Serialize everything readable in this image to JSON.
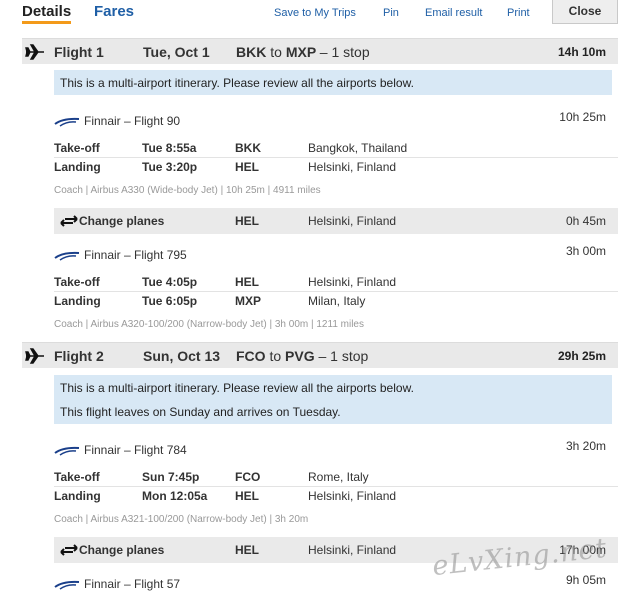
{
  "tabs": {
    "details": "Details",
    "fares": "Fares"
  },
  "toolbar": {
    "save": "Save to My Trips",
    "pin": "Pin",
    "email": "Email result",
    "print": "Print",
    "close": "Close"
  },
  "flights": [
    {
      "label": "Flight 1",
      "date": "Tue, Oct 1",
      "from": "BKK",
      "to_word": "to",
      "to": "MXP",
      "stops": "– 1 stop",
      "duration": "14h 10m",
      "notices": [
        "This is a multi-airport itinerary. Please review all the airports below."
      ],
      "segments": [
        {
          "carrier": "Finnair – Flight 90",
          "duration": "10h 25m",
          "takeoff": {
            "label": "Take-off",
            "time": "Tue 8:55a",
            "code": "BKK",
            "city": "Bangkok, Thailand"
          },
          "landing": {
            "label": "Landing",
            "time": "Tue 3:20p",
            "code": "HEL",
            "city": "Helsinki, Finland"
          },
          "meta": "Coach  |  Airbus A330 (Wide-body Jet)  |  10h 25m  |  4911 miles"
        },
        {
          "carrier": "Finnair – Flight 795",
          "duration": "3h 00m",
          "takeoff": {
            "label": "Take-off",
            "time": "Tue 4:05p",
            "code": "HEL",
            "city": "Helsinki, Finland"
          },
          "landing": {
            "label": "Landing",
            "time": "Tue 6:05p",
            "code": "MXP",
            "city": "Milan, Italy"
          },
          "meta": "Coach  |  Airbus A320-100/200 (Narrow-body Jet)  |  3h 00m  |  1211 miles"
        }
      ],
      "change": {
        "label": "Change planes",
        "code": "HEL",
        "city": "Helsinki, Finland",
        "duration": "0h 45m"
      }
    },
    {
      "label": "Flight 2",
      "date": "Sun, Oct 13",
      "from": "FCO",
      "to_word": "to",
      "to": "PVG",
      "stops": "– 1 stop",
      "duration": "29h 25m",
      "notices": [
        "This is a multi-airport itinerary. Please review all the airports below.",
        "This flight leaves on Sunday and arrives on Tuesday."
      ],
      "segments": [
        {
          "carrier": "Finnair – Flight 784",
          "duration": "3h 20m",
          "takeoff": {
            "label": "Take-off",
            "time": "Sun 7:45p",
            "code": "FCO",
            "city": "Rome, Italy"
          },
          "landing": {
            "label": "Landing",
            "time": "Mon 12:05a",
            "code": "HEL",
            "city": "Helsinki, Finland"
          },
          "meta": "Coach  |  Airbus A321-100/200 (Narrow-body Jet)  |  3h 20m"
        },
        {
          "carrier": "Finnair – Flight 57",
          "duration": "9h 05m"
        }
      ],
      "change": {
        "label": "Change planes",
        "code": "HEL",
        "city": "Helsinki, Finland",
        "duration": "17h 00m"
      }
    }
  ],
  "watermark": "eLvXing.net",
  "colors": {
    "accent": "#f39a1a",
    "link": "#1f5fa6",
    "notice_bg": "#d8e8f5",
    "header_bg": "#e9e9e9"
  },
  "icons": {
    "plane": "plane-icon",
    "change": "change-planes-icon",
    "airline": "finnair-logo"
  }
}
